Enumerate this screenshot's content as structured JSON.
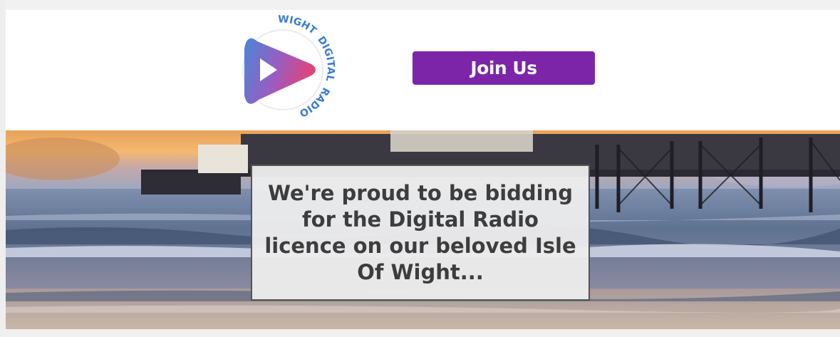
{
  "logo": {
    "ring_text_top": "WIGHT",
    "ring_text_side": "DIGITAL",
    "ring_text_bottom": "RADIO",
    "gradient_colors": [
      "#4b86d8",
      "#e0447a"
    ]
  },
  "header": {
    "join_label": "Join Us",
    "join_color": "#7d25a9"
  },
  "hero": {
    "caption": "We're proud to be bidding for the Digital Radio licence on our beloved Isle Of Wight..."
  }
}
